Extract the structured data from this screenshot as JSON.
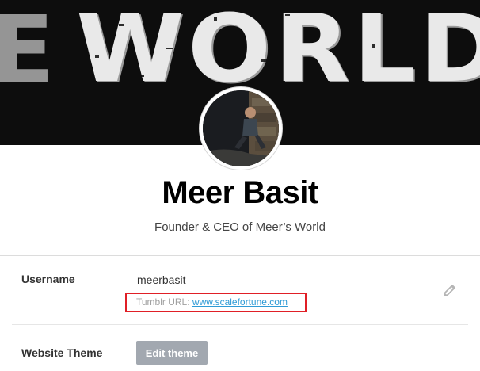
{
  "banner": {
    "text": "WORLD",
    "edge_text": "E"
  },
  "profile": {
    "name": "Meer Basit",
    "tagline": "Founder & CEO of Meer’s World"
  },
  "settings": {
    "username_label": "Username",
    "username_value": "meerbasit",
    "tumblr_url_label": "Tumblr URL: ",
    "tumblr_url_value": "www.scalefortune.com",
    "theme_label": "Website Theme",
    "edit_theme_button": "Edit theme"
  },
  "icons": {
    "edit": "pencil-icon"
  },
  "colors": {
    "banner_bg": "#0d0d0d",
    "highlight_border": "#e01f26",
    "link": "#2f9bd6",
    "button_bg": "#a2a8b0"
  }
}
